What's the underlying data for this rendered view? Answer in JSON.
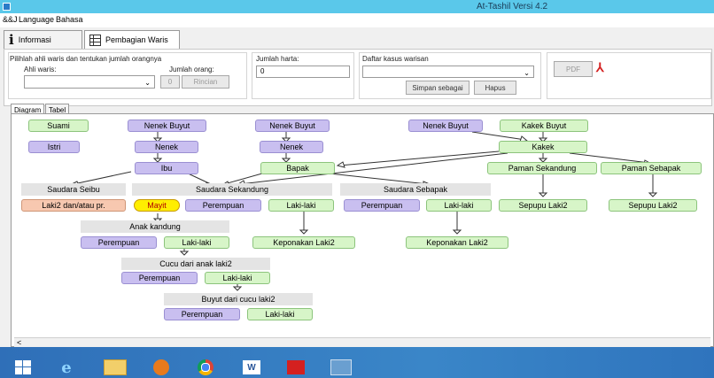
{
  "window": {
    "title": "At-Tashil Versi 4.2"
  },
  "menu": {
    "items": [
      "&&J",
      "Language",
      "Bahasa"
    ]
  },
  "tabs": {
    "informasi": "Informasi",
    "pembagian": "Pembagian Waris"
  },
  "form": {
    "group_label": "Pilihlah ahli waris dan tentukan jumlah orangnya",
    "ahli_waris_label": "Ahli waris:",
    "jumlah_orang_label": "Jumlah orang:",
    "jumlah_orang_value": "0",
    "rincian": "Rincian",
    "jumlah_harta_label": "Jumlah harta:",
    "jumlah_harta_value": "0",
    "daftar_label": "Daftar kasus warisan",
    "simpan": "Simpan sebagai",
    "hapus": "Hapus",
    "pdf": "PDF"
  },
  "subtabs": {
    "diagram": "Diagram",
    "tabel": "Tabel"
  },
  "diagram": {
    "suami": "Suami",
    "istri": "Istri",
    "nenek_buyut_1": "Nenek Buyut",
    "nenek_1": "Nenek",
    "ibu": "Ibu",
    "nenek_buyut_2": "Nenek Buyut",
    "nenek_2": "Nenek",
    "bapak": "Bapak",
    "nenek_buyut_3": "Nenek Buyut",
    "kakek_buyut": "Kakek Buyut",
    "kakek": "Kakek",
    "paman_sekandung": "Paman Sekandung",
    "paman_sebapak": "Paman Sebapak",
    "sepupu_1": "Sepupu Laki2",
    "sepupu_2": "Sepupu Laki2",
    "saudara_seibu": "Saudara Seibu",
    "saudara_sekandung": "Saudara Sekandung",
    "saudara_sebapak": "Saudara Sebapak",
    "laki2_pr": "Laki2 dan/atau pr.",
    "mayit": "Mayit",
    "perempuan_1": "Perempuan",
    "lakilaki_1": "Laki-laki",
    "perempuan_2": "Perempuan",
    "lakilaki_2": "Laki-laki",
    "anak_kandung": "Anak kandung",
    "perempuan_3": "Perempuan",
    "lakilaki_3": "Laki-laki",
    "keponakan_1": "Keponakan Laki2",
    "keponakan_2": "Keponakan Laki2",
    "cucu": "Cucu dari anak laki2",
    "perempuan_4": "Perempuan",
    "lakilaki_4": "Laki-laki",
    "buyut": "Buyut dari cucu laki2",
    "perempuan_5": "Perempuan",
    "lakilaki_5": "Laki-laki"
  },
  "scrollbar": {
    "arrow": "<"
  },
  "colors": {
    "titlebar": "#5ac8ea",
    "purple_node": "#c9bff0",
    "green_node": "#d7f5c8",
    "mayit": "#ffee00"
  },
  "taskbar": {
    "icons": [
      "windows-start-icon",
      "ie-icon",
      "folder-icon",
      "media-icon",
      "chrome-icon",
      "word-icon",
      "pdf-icon",
      "app-icon"
    ]
  }
}
